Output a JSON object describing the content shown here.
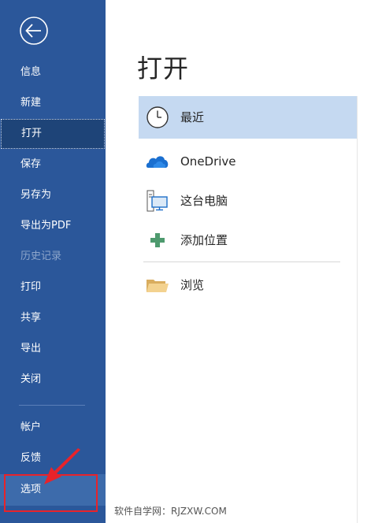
{
  "sidebar": {
    "back_icon": "back-arrow-icon",
    "items": [
      {
        "label": "信息"
      },
      {
        "label": "新建"
      },
      {
        "label": "打开"
      },
      {
        "label": "保存"
      },
      {
        "label": "另存为"
      },
      {
        "label": "导出为PDF"
      },
      {
        "label": "历史记录"
      },
      {
        "label": "打印"
      },
      {
        "label": "共享"
      },
      {
        "label": "导出"
      },
      {
        "label": "关闭"
      }
    ],
    "bottom_items": [
      {
        "label": "帐户"
      },
      {
        "label": "反馈"
      },
      {
        "label": "选项"
      }
    ]
  },
  "main": {
    "title": "打开",
    "locations": [
      {
        "label": "最近",
        "icon": "clock-icon"
      },
      {
        "label": "OneDrive",
        "icon": "cloud-icon"
      },
      {
        "label": "这台电脑",
        "icon": "computer-icon"
      },
      {
        "label": "添加位置",
        "icon": "plus-icon"
      },
      {
        "label": "浏览",
        "icon": "folder-icon"
      }
    ]
  },
  "watermark": "软件自学网：RJZXW.COM",
  "colors": {
    "sidebar": "#2b579a",
    "sidebar_active": "#1e4478",
    "selected_location": "#c5d9f1",
    "annotation": "#e8232a"
  }
}
